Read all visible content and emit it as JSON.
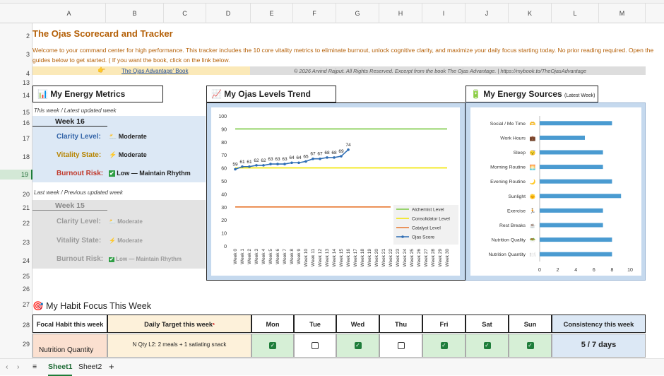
{
  "title": "The Ojas Scorecard and Tracker",
  "welcome": "Welcome to your command center for high performance. This tracker includes the 10 core vitality metrics to eliminate burnout, unlock cognitive clarity, and maximize your daily focus starting today. No prior reading required. Open the guides below to get started. ( If you want the book, click on the link below.",
  "book_link": "The Ojas Advantage' Book",
  "copyright": "© 2026 Arvind Rajput. All Rights Reserved. Excerpt from the book The Ojas Advantage.  |  https://mybook.to/TheOjasAdvantage",
  "columns": [
    "A",
    "B",
    "C",
    "D",
    "E",
    "F",
    "G",
    "H",
    "I",
    "J",
    "K",
    "L",
    "M"
  ],
  "rows": [
    "2",
    "3",
    "4",
    "13",
    "14",
    "15",
    "16",
    "17",
    "18",
    "19",
    "20",
    "21",
    "22",
    "23",
    "24",
    "25",
    "26",
    "27",
    "28",
    "29"
  ],
  "energy": {
    "title": "My Energy Metrics",
    "this_week_note": "This week / Latest updated week",
    "week": "Week 16",
    "clarity_label": "Clarity Level:",
    "clarity_value": "Moderate",
    "vitality_label": "Vitality State:",
    "vitality_value": "Moderate",
    "burnout_label": "Burnout Risk:",
    "burnout_value": "Low — Maintain Rhythm",
    "last_week_note": "Last week / Previous updated week",
    "prev_week": "Week 15",
    "prev_clarity_value": "Moderate",
    "prev_vitality_value": "Moderate",
    "prev_burnout_value": "Low — Maintain Rhythm"
  },
  "trend_title": "My Ojas Levels Trend",
  "sources_title": "My Energy Sources",
  "sources_sub": "(Latest Week)",
  "chart_data": [
    {
      "type": "line",
      "title": "",
      "yticks": [
        "0",
        "10",
        "20",
        "30",
        "40",
        "50",
        "60",
        "70",
        "80",
        "90",
        "100"
      ],
      "ylim": [
        0,
        100
      ],
      "x": [
        "Week 0",
        "Week 1",
        "Week 2",
        "Week 3",
        "Week 4",
        "Week 5",
        "Week 6",
        "Week 7",
        "Week 8",
        "Week 9",
        "Week 10",
        "Week 11",
        "Week 12",
        "Week 13",
        "Week 14",
        "Week 15",
        "Week 16",
        "Week 17",
        "Week 18",
        "Week 19",
        "Week 20",
        "Week 21",
        "Week 22",
        "Week 23",
        "Week 24",
        "Week 25",
        "Week 26",
        "Week 27",
        "Week 28",
        "Week 29",
        "Week 30"
      ],
      "series": [
        {
          "name": "Alchemist Level",
          "color": "#7ac943",
          "values": [
            90
          ]
        },
        {
          "name": "Consolidator Level",
          "color": "#f2e600",
          "values": [
            60
          ]
        },
        {
          "name": "Catalyst Level",
          "color": "#e8742a",
          "values": [
            30
          ]
        },
        {
          "name": "Ojas Score",
          "color": "#2e6db4",
          "values": [
            59,
            61,
            61,
            62,
            62,
            63,
            63,
            63,
            64,
            64,
            65,
            67,
            67,
            68,
            68,
            69,
            74
          ]
        }
      ],
      "point_labels": [
        "59",
        "61",
        "61",
        "62",
        "62",
        "63",
        "63",
        "63",
        "64",
        "64",
        "65",
        "67",
        "67",
        "68",
        "68",
        "69",
        "74"
      ],
      "legend": "bottom-right"
    },
    {
      "type": "bar",
      "orientation": "horizontal",
      "categories": [
        "Social / Me Time",
        "Work Hours",
        "Sleep",
        "Morning Routine",
        "Evening Routine",
        "Sunlight",
        "Exercise",
        "Rest Breaks",
        "Nutrition Quality",
        "Nutrition Quantity"
      ],
      "icons": [
        "🫶",
        "💼",
        "😴",
        "🌅",
        "🌙",
        "🌞",
        "🏃",
        "☕",
        "🥗",
        "🍽️"
      ],
      "values": [
        8,
        5,
        7,
        7,
        8,
        9,
        7,
        7,
        8,
        8
      ],
      "xticks": [
        "0",
        "2",
        "4",
        "6",
        "8",
        "10"
      ],
      "xlim": [
        0,
        10
      ],
      "color": "#4a9bd1"
    }
  ],
  "habit": {
    "title": "My Habit Focus This Week",
    "focal_header": "Focal Habit this week",
    "target_header": "Daily Target this week",
    "target_mark": "*",
    "days": [
      "Mon",
      "Tue",
      "Wed",
      "Thu",
      "Fri",
      "Sat",
      "Sun"
    ],
    "consistency_header": "Consistency this week",
    "focal": "Nutrition Quantity",
    "target": "N Qty L2: 2 meals + 1 satiating snack",
    "checks": [
      true,
      false,
      true,
      false,
      true,
      true,
      true
    ],
    "consistency": "5 / 7 days"
  },
  "sheets": [
    "Sheet1",
    "Sheet2"
  ],
  "add_sheet": "+"
}
